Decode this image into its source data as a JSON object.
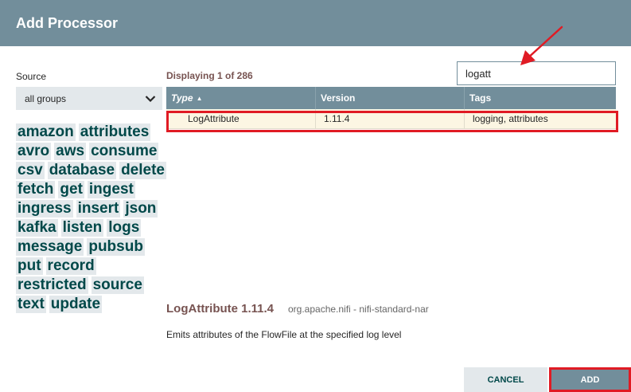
{
  "dialog": {
    "title": "Add Processor"
  },
  "source": {
    "label": "Source",
    "selected": "all groups",
    "icon": "chevron-down-icon"
  },
  "tags": [
    "amazon",
    "attributes",
    "avro",
    "aws",
    "consume",
    "csv",
    "database",
    "delete",
    "fetch",
    "get",
    "ingest",
    "ingress",
    "insert",
    "json",
    "kafka",
    "listen",
    "logs",
    "message",
    "pubsub",
    "put",
    "record",
    "restricted",
    "source",
    "text",
    "update"
  ],
  "status": {
    "displaying": "Displaying 1 of 286"
  },
  "filter": {
    "value": "logatt"
  },
  "table": {
    "headers": {
      "type": "Type",
      "version": "Version",
      "tags": "Tags"
    },
    "sort_icon": "sort-ascending-icon",
    "rows": [
      {
        "type": "LogAttribute",
        "version": "1.11.4",
        "tags": "logging, attributes"
      }
    ]
  },
  "details": {
    "title": "LogAttribute 1.11.4",
    "bundle": "org.apache.nifi - nifi-standard-nar",
    "description": "Emits attributes of the FlowFile at the specified log level"
  },
  "buttons": {
    "cancel": "CANCEL",
    "add": "ADD"
  },
  "colors": {
    "header": "#728e9b",
    "tag_bg": "#e3e8eb",
    "tag_text": "#004849",
    "selected_row": "#fcf6e3",
    "annotation": "#e01b24"
  }
}
